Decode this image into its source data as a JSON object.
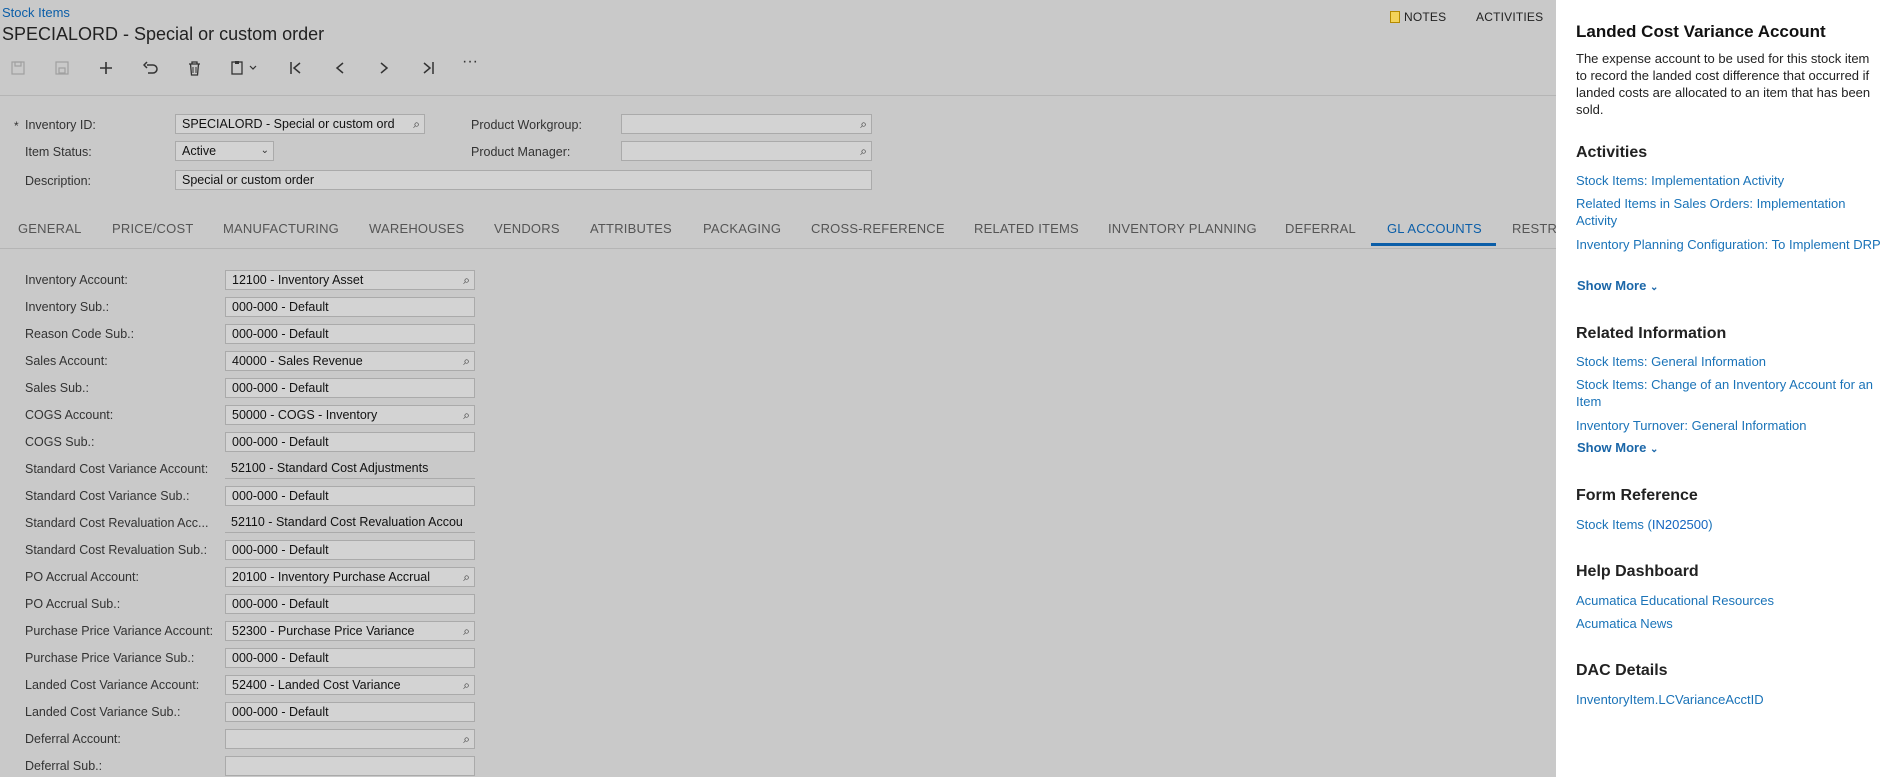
{
  "header": {
    "breadcrumb": "Stock Items",
    "title": "SPECIALORD - Special or custom order",
    "notes": "NOTES",
    "activities": "ACTIVITIES"
  },
  "toolbar": {
    "items": [
      "save-icon",
      "save-close-icon",
      "add-icon",
      "undo-icon",
      "delete-icon",
      "copy-paste-icon",
      "first-icon",
      "prev-icon",
      "next-icon",
      "last-icon",
      "more-icon"
    ],
    "more": "···"
  },
  "summary": {
    "inventory_id_label": "Inventory ID:",
    "inventory_id_value": "SPECIALORD - Special or custom ord",
    "item_status_label": "Item Status:",
    "item_status_value": "Active",
    "description_label": "Description:",
    "description_value": "Special or custom order",
    "product_workgroup_label": "Product Workgroup:",
    "product_workgroup_value": "",
    "product_manager_label": "Product Manager:",
    "product_manager_value": "",
    "required_mark": "*"
  },
  "tabs": [
    "GENERAL",
    "PRICE/COST",
    "MANUFACTURING",
    "WAREHOUSES",
    "VENDORS",
    "ATTRIBUTES",
    "PACKAGING",
    "CROSS-REFERENCE",
    "RELATED ITEMS",
    "INVENTORY PLANNING",
    "DEFERRAL",
    "GL ACCOUNTS",
    "RESTR"
  ],
  "active_tab": "GL ACCOUNTS",
  "gl": {
    "rows": [
      {
        "label": "Inventory Account:",
        "value": "12100 - Inventory Asset",
        "lookup": true
      },
      {
        "label": "Inventory Sub.:",
        "value": "000-000 - Default",
        "lookup": false
      },
      {
        "label": "Reason Code Sub.:",
        "value": "000-000 - Default",
        "lookup": false
      },
      {
        "label": "Sales Account:",
        "value": "40000 - Sales Revenue",
        "lookup": true
      },
      {
        "label": "Sales Sub.:",
        "value": "000-000 - Default",
        "lookup": false
      },
      {
        "label": "COGS Account:",
        "value": "50000 - COGS - Inventory",
        "lookup": true
      },
      {
        "label": "COGS Sub.:",
        "value": "000-000 - Default",
        "lookup": false
      },
      {
        "label": "Standard Cost Variance Account:",
        "value": "52100 - Standard Cost Adjustments",
        "lookup": false
      },
      {
        "label": "Standard Cost Variance Sub.:",
        "value": "000-000 - Default",
        "lookup": false
      },
      {
        "label": "Standard Cost Revaluation Acc...",
        "value": "52110 - Standard Cost Revaluation Accou",
        "lookup": false
      },
      {
        "label": "Standard Cost Revaluation Sub.:",
        "value": "000-000 - Default",
        "lookup": false
      },
      {
        "label": "PO Accrual Account:",
        "value": "20100 - Inventory Purchase Accrual",
        "lookup": true
      },
      {
        "label": "PO Accrual Sub.:",
        "value": "000-000 - Default",
        "lookup": false
      },
      {
        "label": "Purchase Price Variance Account:",
        "value": "52300 - Purchase Price Variance",
        "lookup": true
      },
      {
        "label": "Purchase Price Variance Sub.:",
        "value": "000-000 - Default",
        "lookup": false
      },
      {
        "label": "Landed Cost Variance Account:",
        "value": "52400 - Landed Cost Variance",
        "lookup": true
      },
      {
        "label": "Landed Cost Variance Sub.:",
        "value": "000-000 - Default",
        "lookup": false
      },
      {
        "label": "Deferral Account:",
        "value": "",
        "lookup": true
      },
      {
        "label": "Deferral Sub.:",
        "value": "",
        "lookup": false
      }
    ]
  },
  "help": {
    "title": "Landed Cost Variance Account",
    "description": "The expense account to be used for this stock item to record the landed cost difference that occurred if landed costs are allocated to an item that has been sold.",
    "activities_title": "Activities",
    "activities": [
      "Stock Items: Implementation Activity",
      "Related Items in Sales Orders: Implementation Activity",
      "Inventory Planning Configuration: To Implement DRP"
    ],
    "show_more": "Show More",
    "related_title": "Related Information",
    "related": [
      "Stock Items: General Information",
      "Stock Items: Change of an Inventory Account for an Item",
      "Inventory Turnover: General Information"
    ],
    "form_ref_title": "Form Reference",
    "form_ref_name": "Stock Items (",
    "form_ref_id": "IN202500",
    "form_ref_close": ")",
    "dashboard_title": "Help Dashboard",
    "dashboard": [
      "Acumatica Educational Resources",
      "Acumatica News"
    ],
    "dac_title": "DAC Details",
    "dac": "InventoryItem.LCVarianceAcctID"
  }
}
